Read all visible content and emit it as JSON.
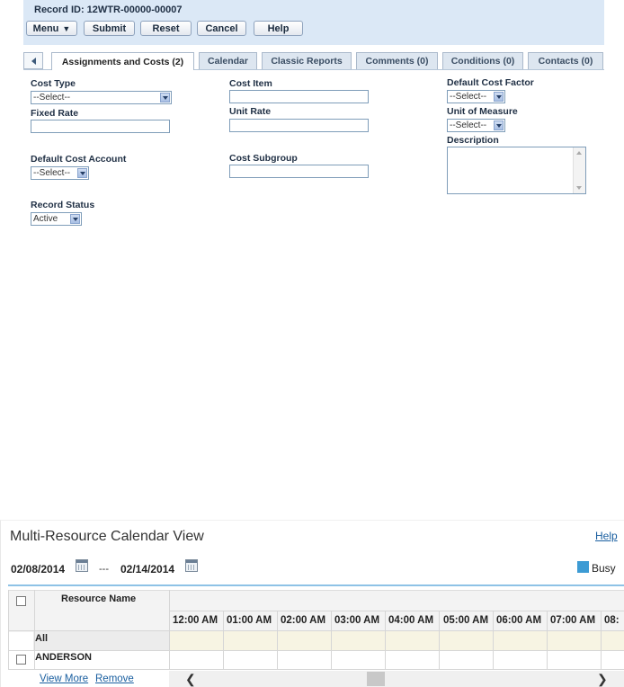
{
  "header": {
    "record_id": "Record ID: 12WTR-00000-00007",
    "buttons": {
      "menu": "Menu",
      "submit": "Submit",
      "reset": "Reset",
      "cancel": "Cancel",
      "help": "Help"
    }
  },
  "tabs": [
    {
      "label": "Assignments and Costs (2)",
      "active": true
    },
    {
      "label": "Calendar",
      "active": false
    },
    {
      "label": "Classic Reports",
      "active": false
    },
    {
      "label": "Comments (0)",
      "active": false
    },
    {
      "label": "Conditions (0)",
      "active": false
    },
    {
      "label": "Contacts (0)",
      "active": false
    }
  ],
  "form": {
    "cost_type": {
      "label": "Cost Type",
      "value": "--Select--"
    },
    "fixed_rate": {
      "label": "Fixed Rate",
      "value": ""
    },
    "default_cost_account": {
      "label": "Default Cost Account",
      "value": "--Select--"
    },
    "record_status": {
      "label": "Record Status",
      "value": "Active"
    },
    "cost_item": {
      "label": "Cost Item",
      "value": ""
    },
    "unit_rate": {
      "label": "Unit Rate",
      "value": ""
    },
    "cost_subgroup": {
      "label": "Cost Subgroup",
      "value": ""
    },
    "default_cost_factor": {
      "label": "Default Cost Factor",
      "value": "--Select--"
    },
    "unit_of_measure": {
      "label": "Unit of Measure",
      "value": "--Select--"
    },
    "description": {
      "label": "Description",
      "value": ""
    }
  },
  "calendar": {
    "title": "Multi-Resource Calendar View",
    "help": "Help",
    "start_date": "02/08/2014",
    "separator": "---",
    "end_date": "02/14/2014",
    "legend": {
      "label": "Busy",
      "color": "#3d9bd4"
    },
    "column_title": "Resource Name",
    "hours": [
      "12:00 AM",
      "01:00 AM",
      "02:00 AM",
      "03:00 AM",
      "04:00 AM",
      "05:00 AM",
      "06:00 AM",
      "07:00 AM",
      "08:"
    ],
    "rows": [
      {
        "name": "All"
      },
      {
        "name": "ANDERSON"
      }
    ],
    "footer": {
      "view_more": "View More",
      "remove": "Remove"
    }
  }
}
